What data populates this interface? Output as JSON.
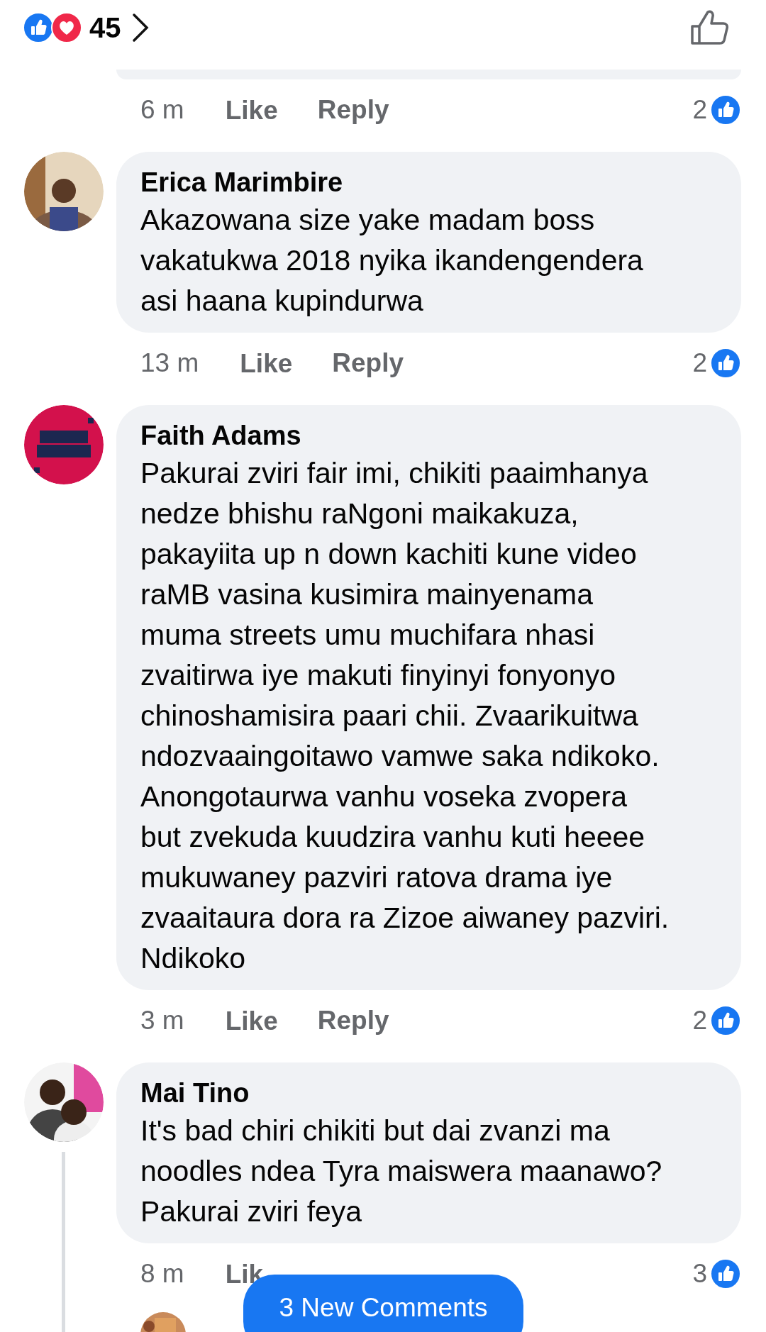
{
  "reactions": {
    "count": "45"
  },
  "comments": [
    {
      "kind": "cut",
      "time": "6 m",
      "like": "Like",
      "reply": "Reply",
      "likes": "2"
    },
    {
      "kind": "full",
      "name": "Erica Marimbire",
      "text": "Akazowana size yake madam boss\nvakatukwa 2018 nyika ikandengendera\nasi haana kupindurwa",
      "time": "13 m",
      "like": "Like",
      "reply": "Reply",
      "likes": "2"
    },
    {
      "kind": "full",
      "name": "Faith Adams",
      "text": "Pakurai zviri fair imi, chikiti paaimhanya\nnedze bhishu raNgoni maikakuza,\npakayiita up n down kachiti kune video\nraMB vasina kusimira mainyenama\nmuma streets umu muchifara nhasi\nzvaitirwa iye makuti finyinyi fonyonyo\nchinoshamisira paari chii. Zvaarikuitwa\nndozvaaingoitawo vamwe saka ndikoko.\nAnongotaurwa vanhu voseka zvopera\nbut zvekuda kuudzira vanhu kuti heeee\nmukuwaney pazviri ratova drama iye\nzvaaitaura dora ra Zizoe aiwaney pazviri.\nNdikoko",
      "time": "3 m",
      "like": "Like",
      "reply": "Reply",
      "likes": "2"
    },
    {
      "kind": "full",
      "name": "Mai Tino",
      "text": "It's bad chiri chikiti but dai zvanzi ma\nnoodles ndea Tyra maiswera maanawo?\nPakurai zviri feya",
      "time": "8 m",
      "like": "Lik",
      "likes": "3",
      "thread": true
    }
  ],
  "new_comments_button": {
    "label": "3 New Comments"
  }
}
